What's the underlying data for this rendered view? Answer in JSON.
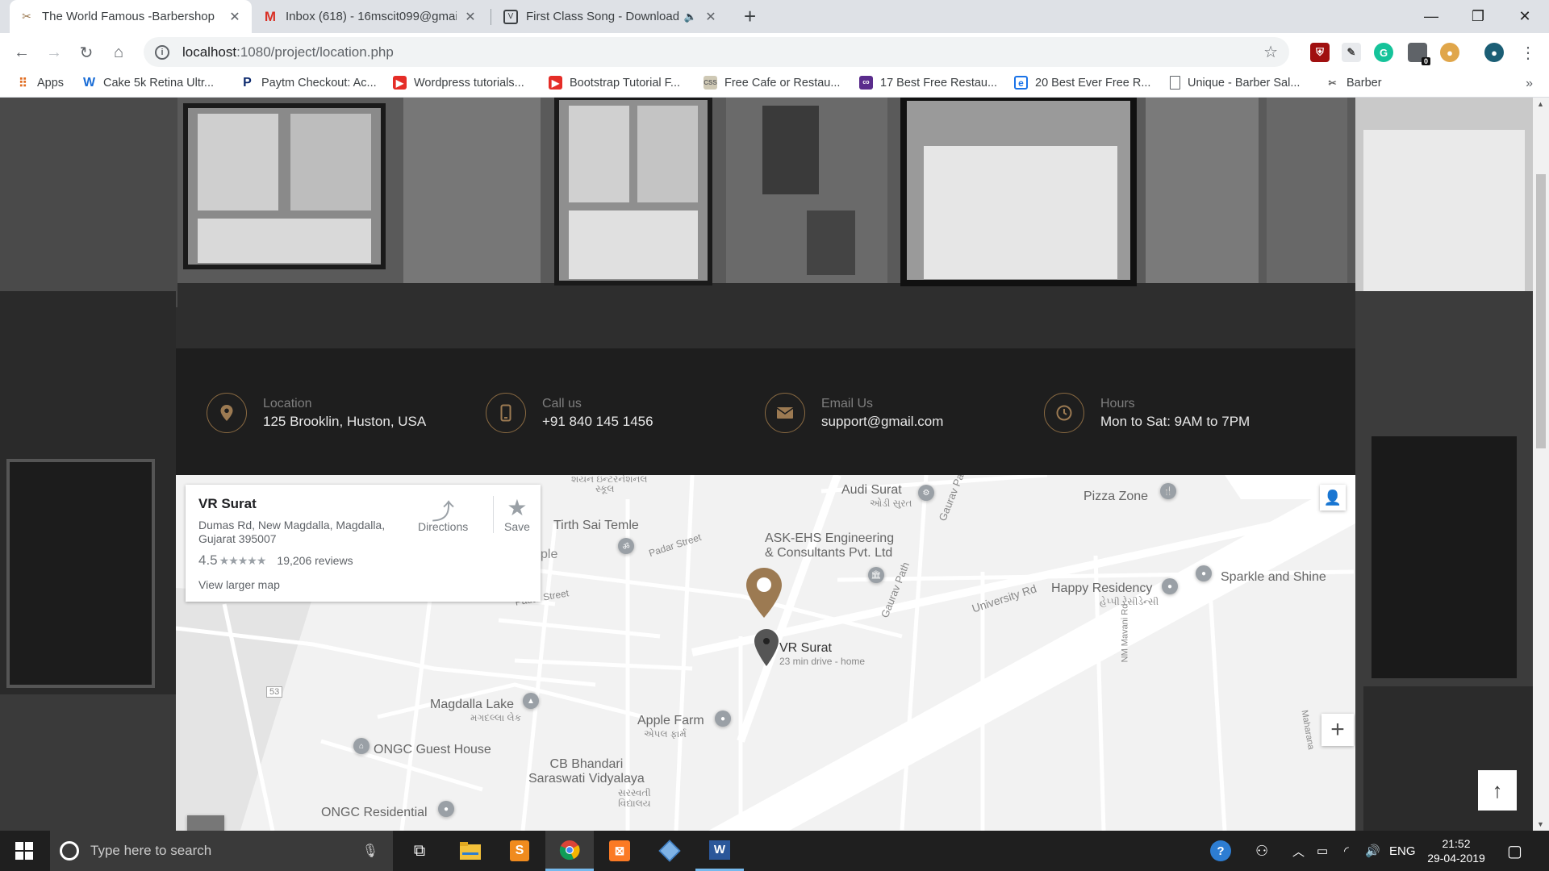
{
  "browser": {
    "tabs": [
      {
        "title": "The World Famous -Barbershop",
        "active": true
      },
      {
        "title": "Inbox (618) - 16mscit099@gmail",
        "active": false
      },
      {
        "title": "First Class Song - Download",
        "active": false
      }
    ],
    "url_host": "localhost",
    "url_path": ":1080/project/location.php",
    "bookmarks": [
      "Apps",
      "Cake 5k Retina Ultr...",
      "Paytm Checkout: Ac...",
      "Wordpress tutorials...",
      "Bootstrap Tutorial F...",
      "Free Cafe or Restau...",
      "17 Best Free Restau...",
      "20 Best Ever Free R...",
      "Unique - Barber Sal...",
      "Barber"
    ],
    "extension_badge": "0"
  },
  "info": [
    {
      "label": "Location",
      "value": "125 Brooklin, Huston, USA",
      "icon": "location-pin-icon"
    },
    {
      "label": "Call us",
      "value": "+91 840 145 1456",
      "icon": "phone-icon"
    },
    {
      "label": "Email Us",
      "value": "support@gmail.com",
      "icon": "envelope-icon"
    },
    {
      "label": "Hours",
      "value": "Mon to Sat: 9AM to 7PM",
      "icon": "clock-icon"
    }
  ],
  "map": {
    "card": {
      "place": "VR Surat",
      "address": "Dumas Rd, New Magdalla, Magdalla, Gujarat 395007",
      "rating": "4.5",
      "stars": "★★★★★",
      "reviews": "19,206 reviews",
      "directions": "Directions",
      "save": "Save",
      "view_larger": "View larger map"
    },
    "labels": {
      "audi": "Audi Surat",
      "audi_local": "ઓડી સુરત",
      "pizza": "Pizza Zone",
      "tirth": "Tirth Sai Temle",
      "padar_street": "Padar Street",
      "padar_street2": "Padar Street",
      "ask_ehs_1": "ASK-EHS Engineering",
      "ask_ehs_2": "& Consultants Pvt. Ltd",
      "gaurav_path": "Gaurav Path",
      "gaurav_path2": "Gaurav Pa",
      "sparkle": "Sparkle and Shine",
      "happy": "Happy Residency",
      "happy_local": "હેપ્પી રેસીડેન્સી",
      "university": "University Rd",
      "vr_surat": "VR Surat",
      "vr_drive": "23 min drive - home",
      "nm_mavani": "NM Mavani Rd",
      "magdalla_lake": "Magdalla Lake",
      "magdalla_lake_local": "મગદલ્લા લેક",
      "apple_farm": "Apple Farm",
      "apple_farm_local": "એપલ ફાર્મ",
      "ongc_guest": "ONGC Guest House",
      "cb_bhandari_1": "CB Bhandari",
      "cb_bhandari_2": "Saraswati Vidyalaya",
      "cb_local_1": "સરસ્વતી",
      "cb_local_2": "વિદ્યાલય",
      "ongc_res": "ONGC Residential",
      "route_53": "53",
      "maharana": "Maharana",
      "school_top_1": "શયન ઇન્ટરનેશનલ",
      "school_top_2": "સ્કૂલ",
      "ple": "ple"
    },
    "accent_color": "#9c7a52"
  },
  "taskbar": {
    "search_placeholder": "Type here to search",
    "language": "ENG",
    "time": "21:52",
    "date": "29-04-2019"
  }
}
